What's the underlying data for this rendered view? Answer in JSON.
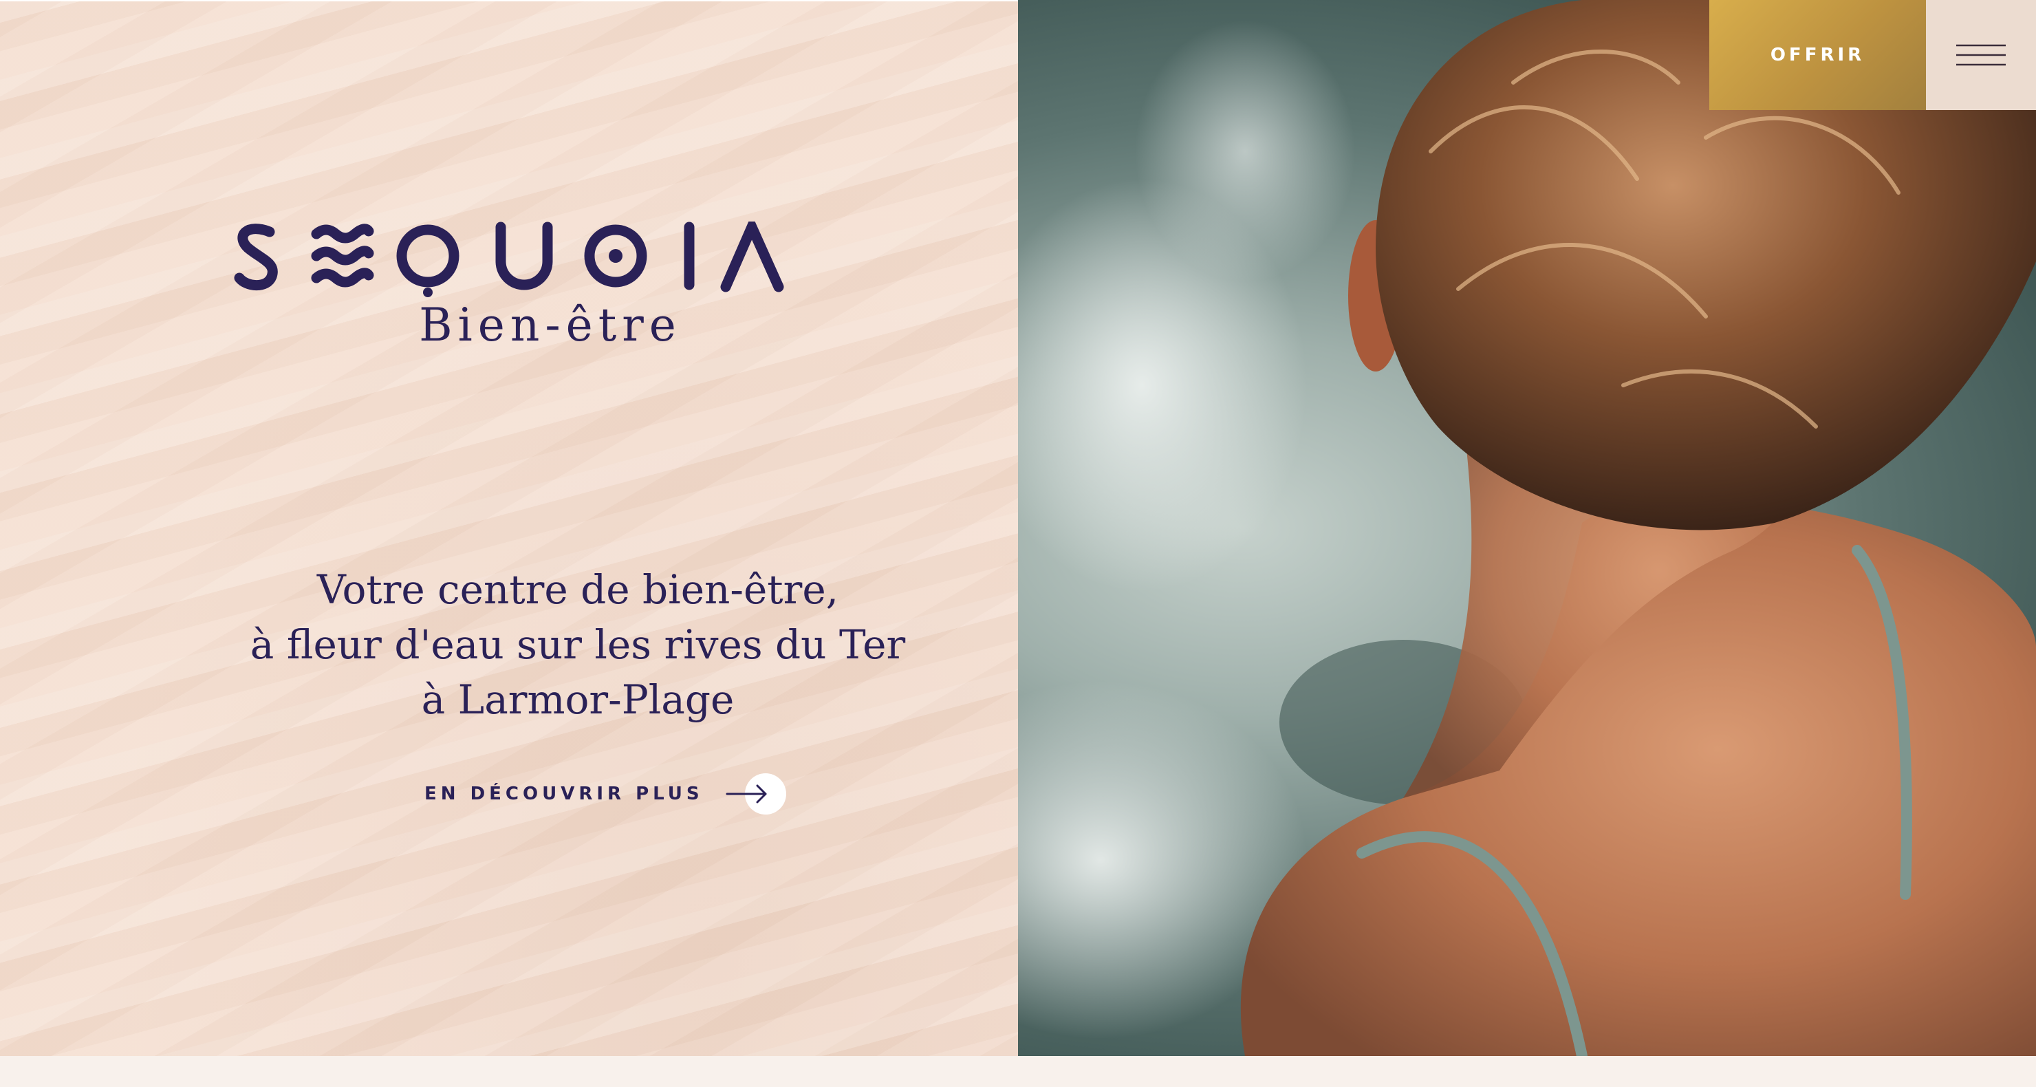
{
  "brand": {
    "name": "SEQUOIA",
    "tagline": "Bien-être",
    "color": "#2a2157"
  },
  "hero": {
    "headline_lines": [
      "Votre centre de bien-être,",
      "à fleur d'eau sur les rives du Ter",
      "à Larmor-Plage"
    ],
    "cta_label": "EN DÉCOUVRIR PLUS",
    "cta_icon": "arrow-right-icon"
  },
  "header": {
    "offer_button_label": "OFFRIR",
    "offer_button_color": "#c9a245",
    "menu_icon": "hamburger-menu-icon"
  },
  "colors": {
    "sand": "#f5dfd1",
    "page_bg": "#f8f1ec",
    "menu_bg": "#ecdcd0"
  }
}
